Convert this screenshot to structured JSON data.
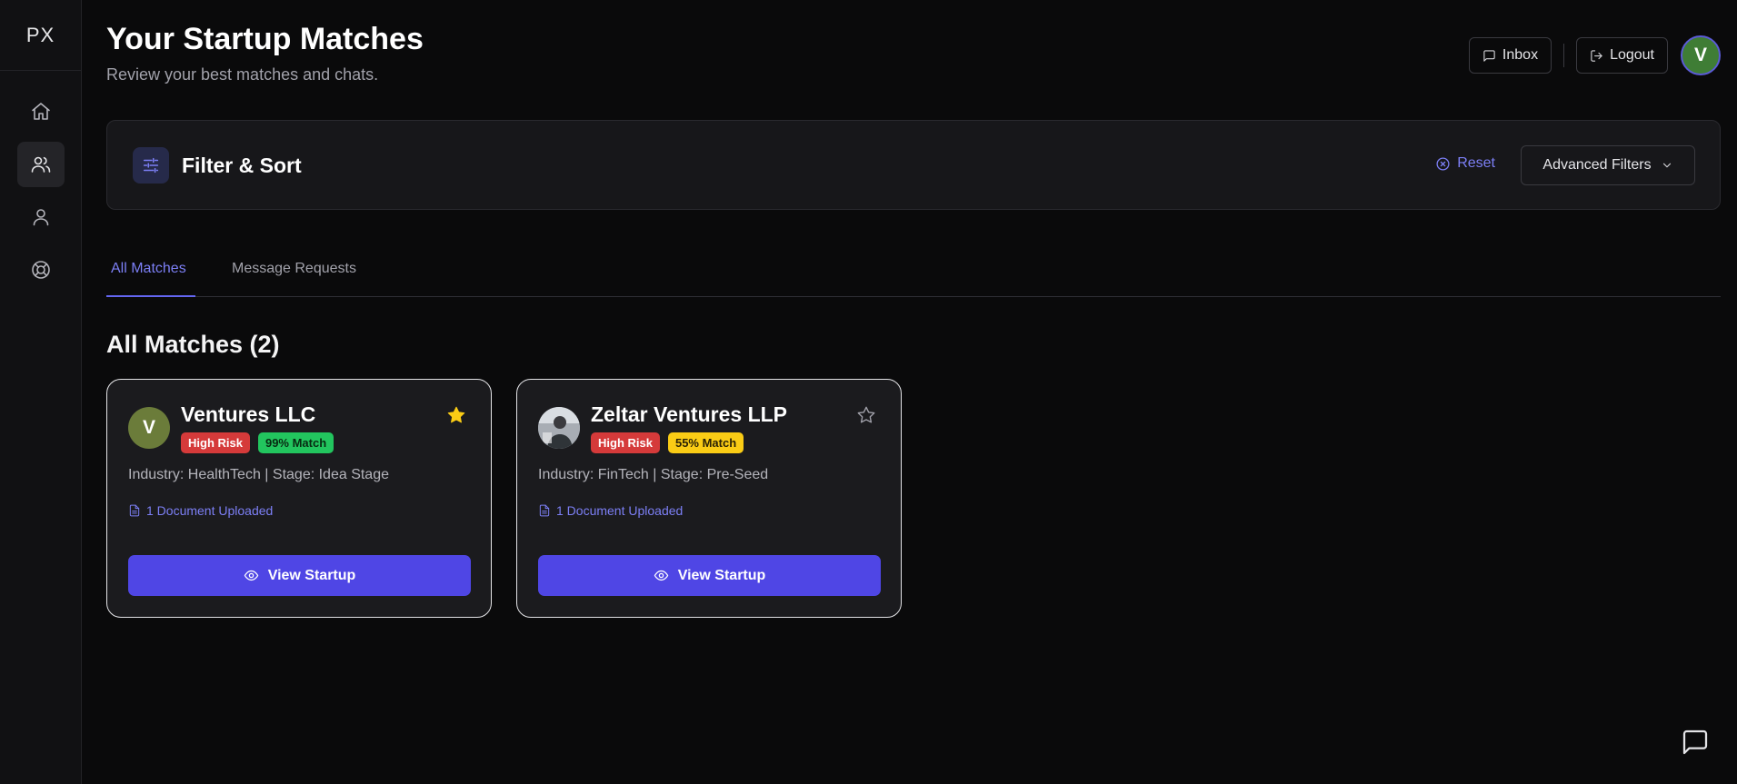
{
  "app": {
    "logo": "PX"
  },
  "sidebar": {
    "items": [
      {
        "icon": "home-icon",
        "active": false
      },
      {
        "icon": "users-icon",
        "active": true
      },
      {
        "icon": "user-icon",
        "active": false
      },
      {
        "icon": "lifebuoy-icon",
        "active": false
      }
    ]
  },
  "header": {
    "title": "Your Startup Matches",
    "subtitle": "Review your best matches and chats.",
    "inbox_label": "Inbox",
    "logout_label": "Logout",
    "avatar_initial": "V"
  },
  "filter": {
    "title": "Filter & Sort",
    "reset_label": "Reset",
    "advanced_label": "Advanced Filters"
  },
  "tabs": [
    {
      "label": "All Matches",
      "active": true
    },
    {
      "label": "Message Requests",
      "active": false
    }
  ],
  "section_title": "All Matches (2)",
  "matches": [
    {
      "name": "Ventures LLC",
      "avatar_initial": "V",
      "avatar_color": "#6b7c3a",
      "risk": "High Risk",
      "match": "99% Match",
      "match_color": "#22c55e",
      "details": "Industry: HealthTech | Stage: Idea Stage",
      "documents": "1 Document Uploaded",
      "starred": true,
      "button": "View Startup"
    },
    {
      "name": "Zeltar Ventures LLP",
      "avatar_initial": "",
      "avatar_color": "#6b7280",
      "risk": "High Risk",
      "match": "55% Match",
      "match_color": "#facc15",
      "details": "Industry: FinTech | Stage: Pre-Seed",
      "documents": "1 Document Uploaded",
      "starred": false,
      "button": "View Startup"
    }
  ],
  "colors": {
    "accent": "#4f46e5",
    "link": "#7c7ff5",
    "star": "#facc15",
    "danger": "#d53a3a"
  }
}
